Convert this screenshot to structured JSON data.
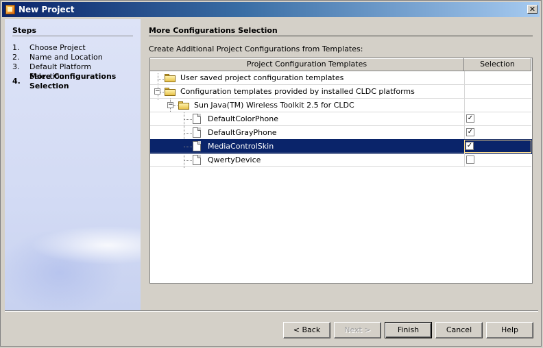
{
  "window": {
    "title": "New Project",
    "close_glyph": "✕"
  },
  "steps": {
    "title": "Steps",
    "items": [
      {
        "num": "1.",
        "label": "Choose Project"
      },
      {
        "num": "2.",
        "label": "Name and Location"
      },
      {
        "num": "3.",
        "label": "Default Platform Selection"
      },
      {
        "num": "4.",
        "label": "More Configurations Selection",
        "active": true
      }
    ]
  },
  "main": {
    "title": "More Configurations Selection",
    "description": "Create Additional Project Configurations from Templates:",
    "columns": [
      "Project Configuration Templates",
      "Selection"
    ],
    "rows": [
      {
        "label": "User saved project configuration templates",
        "icon": "folder-icon",
        "checkbox": null,
        "selected": false
      },
      {
        "label": "Configuration templates provided by installed CLDC platforms",
        "icon": "folder-icon",
        "expander": "−",
        "checkbox": null,
        "selected": false
      },
      {
        "label": "Sun Java(TM) Wireless Toolkit 2.5 for CLDC",
        "icon": "folder-icon",
        "expander": "−",
        "checkbox": null,
        "selected": false
      },
      {
        "label": "DefaultColorPhone",
        "icon": "document-icon",
        "checkbox": true,
        "selected": false
      },
      {
        "label": "DefaultGrayPhone",
        "icon": "document-icon",
        "checkbox": true,
        "selected": false
      },
      {
        "label": "MediaControlSkin",
        "icon": "document-icon",
        "checkbox": true,
        "selected": true
      },
      {
        "label": "QwertyDevice",
        "icon": "document-icon",
        "checkbox": false,
        "selected": false
      }
    ]
  },
  "buttons": {
    "back": "< Back",
    "next": "Next >",
    "finish": "Finish",
    "cancel": "Cancel",
    "help": "Help"
  },
  "colors": {
    "selection": "#0a246a",
    "titlebar_start": "#0a246a",
    "titlebar_end": "#a6caf0",
    "dialog": "#d4d0c8"
  }
}
